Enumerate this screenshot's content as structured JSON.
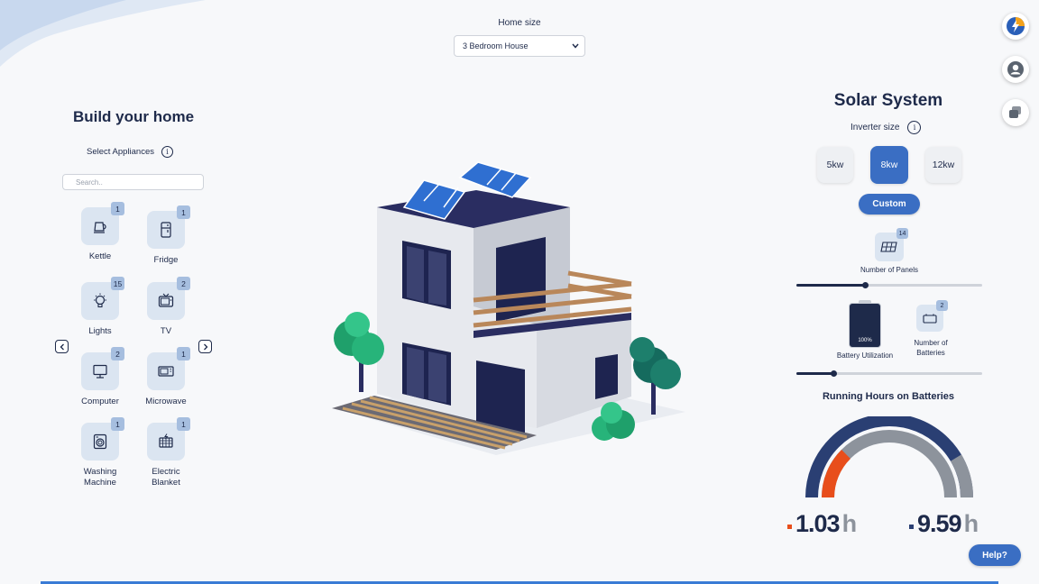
{
  "home_size": {
    "label": "Home size",
    "selected": "3 Bedroom House"
  },
  "build": {
    "title": "Build your home",
    "select_label": "Select Appliances",
    "search_placeholder": "Search..",
    "appliances": [
      {
        "name": "Kettle",
        "count": "1",
        "icon": "kettle-icon"
      },
      {
        "name": "Fridge",
        "count": "1",
        "icon": "fridge-icon"
      },
      {
        "name": "Lights",
        "count": "15",
        "icon": "lightbulb-icon"
      },
      {
        "name": "TV",
        "count": "2",
        "icon": "tv-icon"
      },
      {
        "name": "Computer",
        "count": "2",
        "icon": "computer-icon"
      },
      {
        "name": "Microwave",
        "count": "1",
        "icon": "microwave-icon"
      },
      {
        "name": "Washing Machine",
        "count": "1",
        "icon": "washing-machine-icon"
      },
      {
        "name": "Electric Blanket",
        "count": "1",
        "icon": "electric-blanket-icon"
      }
    ]
  },
  "solar": {
    "title": "Solar System",
    "inverter_label": "Inverter size",
    "inverter_options": [
      "5kw",
      "8kw",
      "12kw"
    ],
    "inverter_selected": "8kw",
    "custom_label": "Custom",
    "panels_count": "14",
    "panels_label": "Number of Panels",
    "panels_slider_fraction": 0.37,
    "battery_percent": "100%",
    "battery_label": "Battery Utilization",
    "batteries_count": "2",
    "batteries_label": "Number of Batteries",
    "batteries_slider_fraction": 0.2
  },
  "running": {
    "title": "Running Hours on Batteries",
    "value1": "1.03",
    "value2": "9.59",
    "unit": "h",
    "color1": "#e84e1b",
    "color2": "#2a3f73"
  },
  "help_label": "Help?",
  "side_icons": [
    "lightning-icon",
    "user-icon",
    "chat-icon"
  ],
  "colors": {
    "accent": "#3a6ec3",
    "navy": "#1e2a4a",
    "tile": "#dbe5f1"
  }
}
